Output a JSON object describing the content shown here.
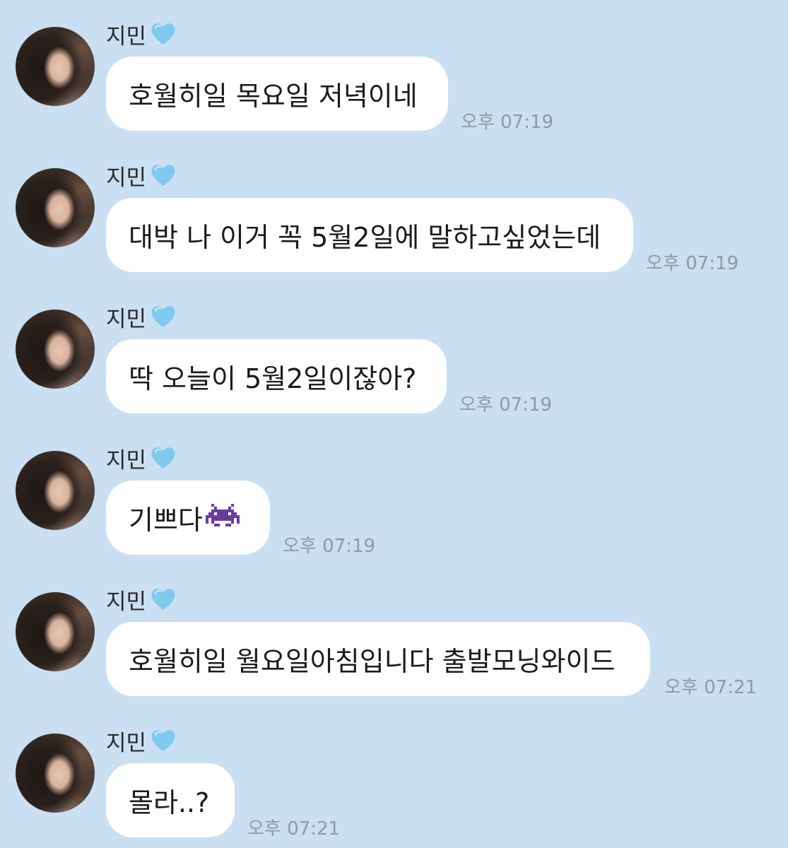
{
  "chat": {
    "messages": [
      {
        "sender": "지민",
        "text": "호월히일 목요일 저녁이네",
        "time": "오후 07:19"
      },
      {
        "sender": "지민",
        "text": "대박 나 이거 꼭 5월2일에 말하고싶었는데",
        "time": "오후 07:19"
      },
      {
        "sender": "지민",
        "text": "딱 오늘이 5월2일이잖아?",
        "time": "오후 07:19"
      },
      {
        "sender": "지민",
        "text": "기쁘다",
        "emoji": "alien-monster-icon",
        "time": "오후 07:19"
      },
      {
        "sender": "지민",
        "text": "호월히일 월요일아침입니다 출발모닝와이드",
        "time": "오후 07:21"
      },
      {
        "sender": "지민",
        "text": "몰라..?",
        "time": "오후 07:21"
      }
    ]
  },
  "colors": {
    "background": "#cadff1",
    "bubble": "#ffffff",
    "timestamp": "#8e9aa6",
    "heart": "#7fc8ee",
    "emoji": "#6a3c9c"
  },
  "icons": {
    "name_suffix": "light-blue-heart-icon"
  }
}
